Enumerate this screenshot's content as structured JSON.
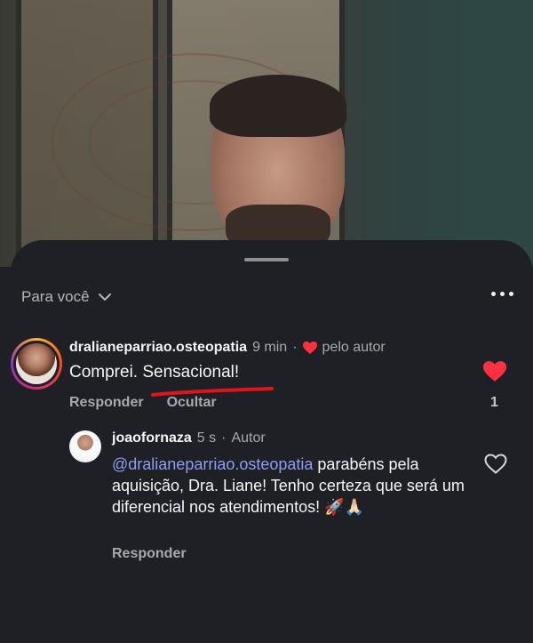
{
  "sheet": {
    "filter_label": "Para você"
  },
  "comment": {
    "username": "dralianeparriao.osteopatia",
    "time": "9 min",
    "separator": "·",
    "liked_by_author": "pelo autor",
    "text_before": "Comprei. ",
    "text_highlight": "Sensacional!",
    "reply_label": "Responder",
    "hide_label": "Ocultar",
    "like_count": "1",
    "liked": true
  },
  "reply": {
    "username": "joaofornaza",
    "time": "5 s",
    "separator": "·",
    "tag": "Autor",
    "mention": "@dralianeparriao.osteopatia",
    "text": " parabéns pela aquisição, Dra. Liane! Tenho certeza que será um diferencial nos atendimentos! 🚀🙏🏻",
    "reply_label": "Responder"
  },
  "colors": {
    "background": "#1f2025",
    "like_red": "#ff3040",
    "mention_blue": "#8e9cf5",
    "muted_text": "#a8a8ad",
    "underline_red": "#e0141b"
  }
}
